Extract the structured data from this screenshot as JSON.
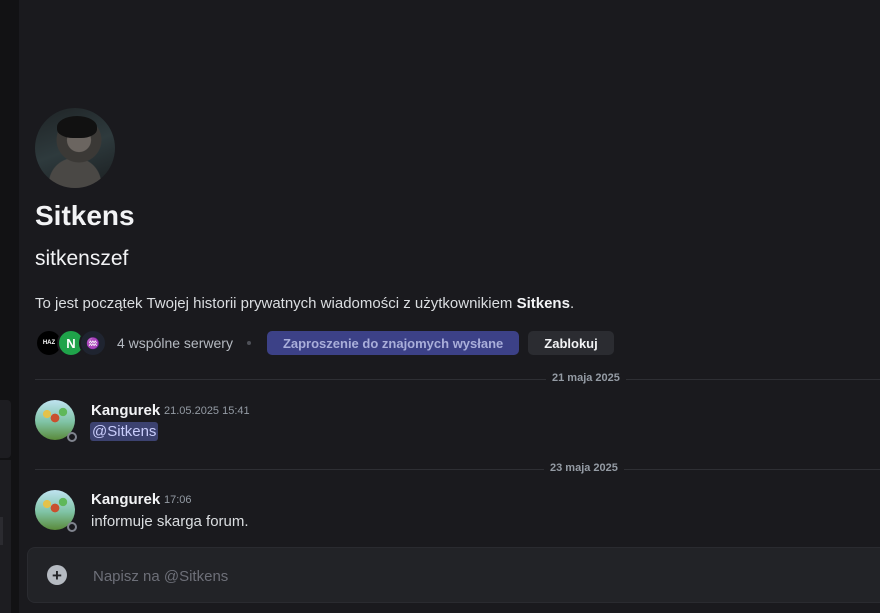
{
  "profile": {
    "display_name": "Sitkens",
    "username": "sitkenszef",
    "intro_prefix": "To jest początek Twojej historii prywatnych wiadomości z użytkownikiem ",
    "intro_name": "Sitkens",
    "intro_suffix": "."
  },
  "mutual": {
    "servers": [
      {
        "label": "HAZ",
        "icon": "server-haz-icon"
      },
      {
        "label": "N",
        "icon": "server-n-icon"
      },
      {
        "label": "♒",
        "icon": "server-wave-icon"
      }
    ],
    "count_label": "4 wspólne serwery"
  },
  "actions": {
    "invite_label": "Zaproszenie do znajomych wysłane",
    "block_label": "Zablokuj"
  },
  "messages": [
    {
      "date": "21 maja 2025",
      "author": "Kangurek",
      "time": "21.05.2025 15:41",
      "mention": "@Sitkens"
    },
    {
      "date": "23 maja 2025",
      "author": "Kangurek",
      "time": "17:06",
      "text": "informuje skarga forum."
    }
  ],
  "composer": {
    "placeholder": "Napisz na @Sitkens",
    "add_label": "+"
  }
}
